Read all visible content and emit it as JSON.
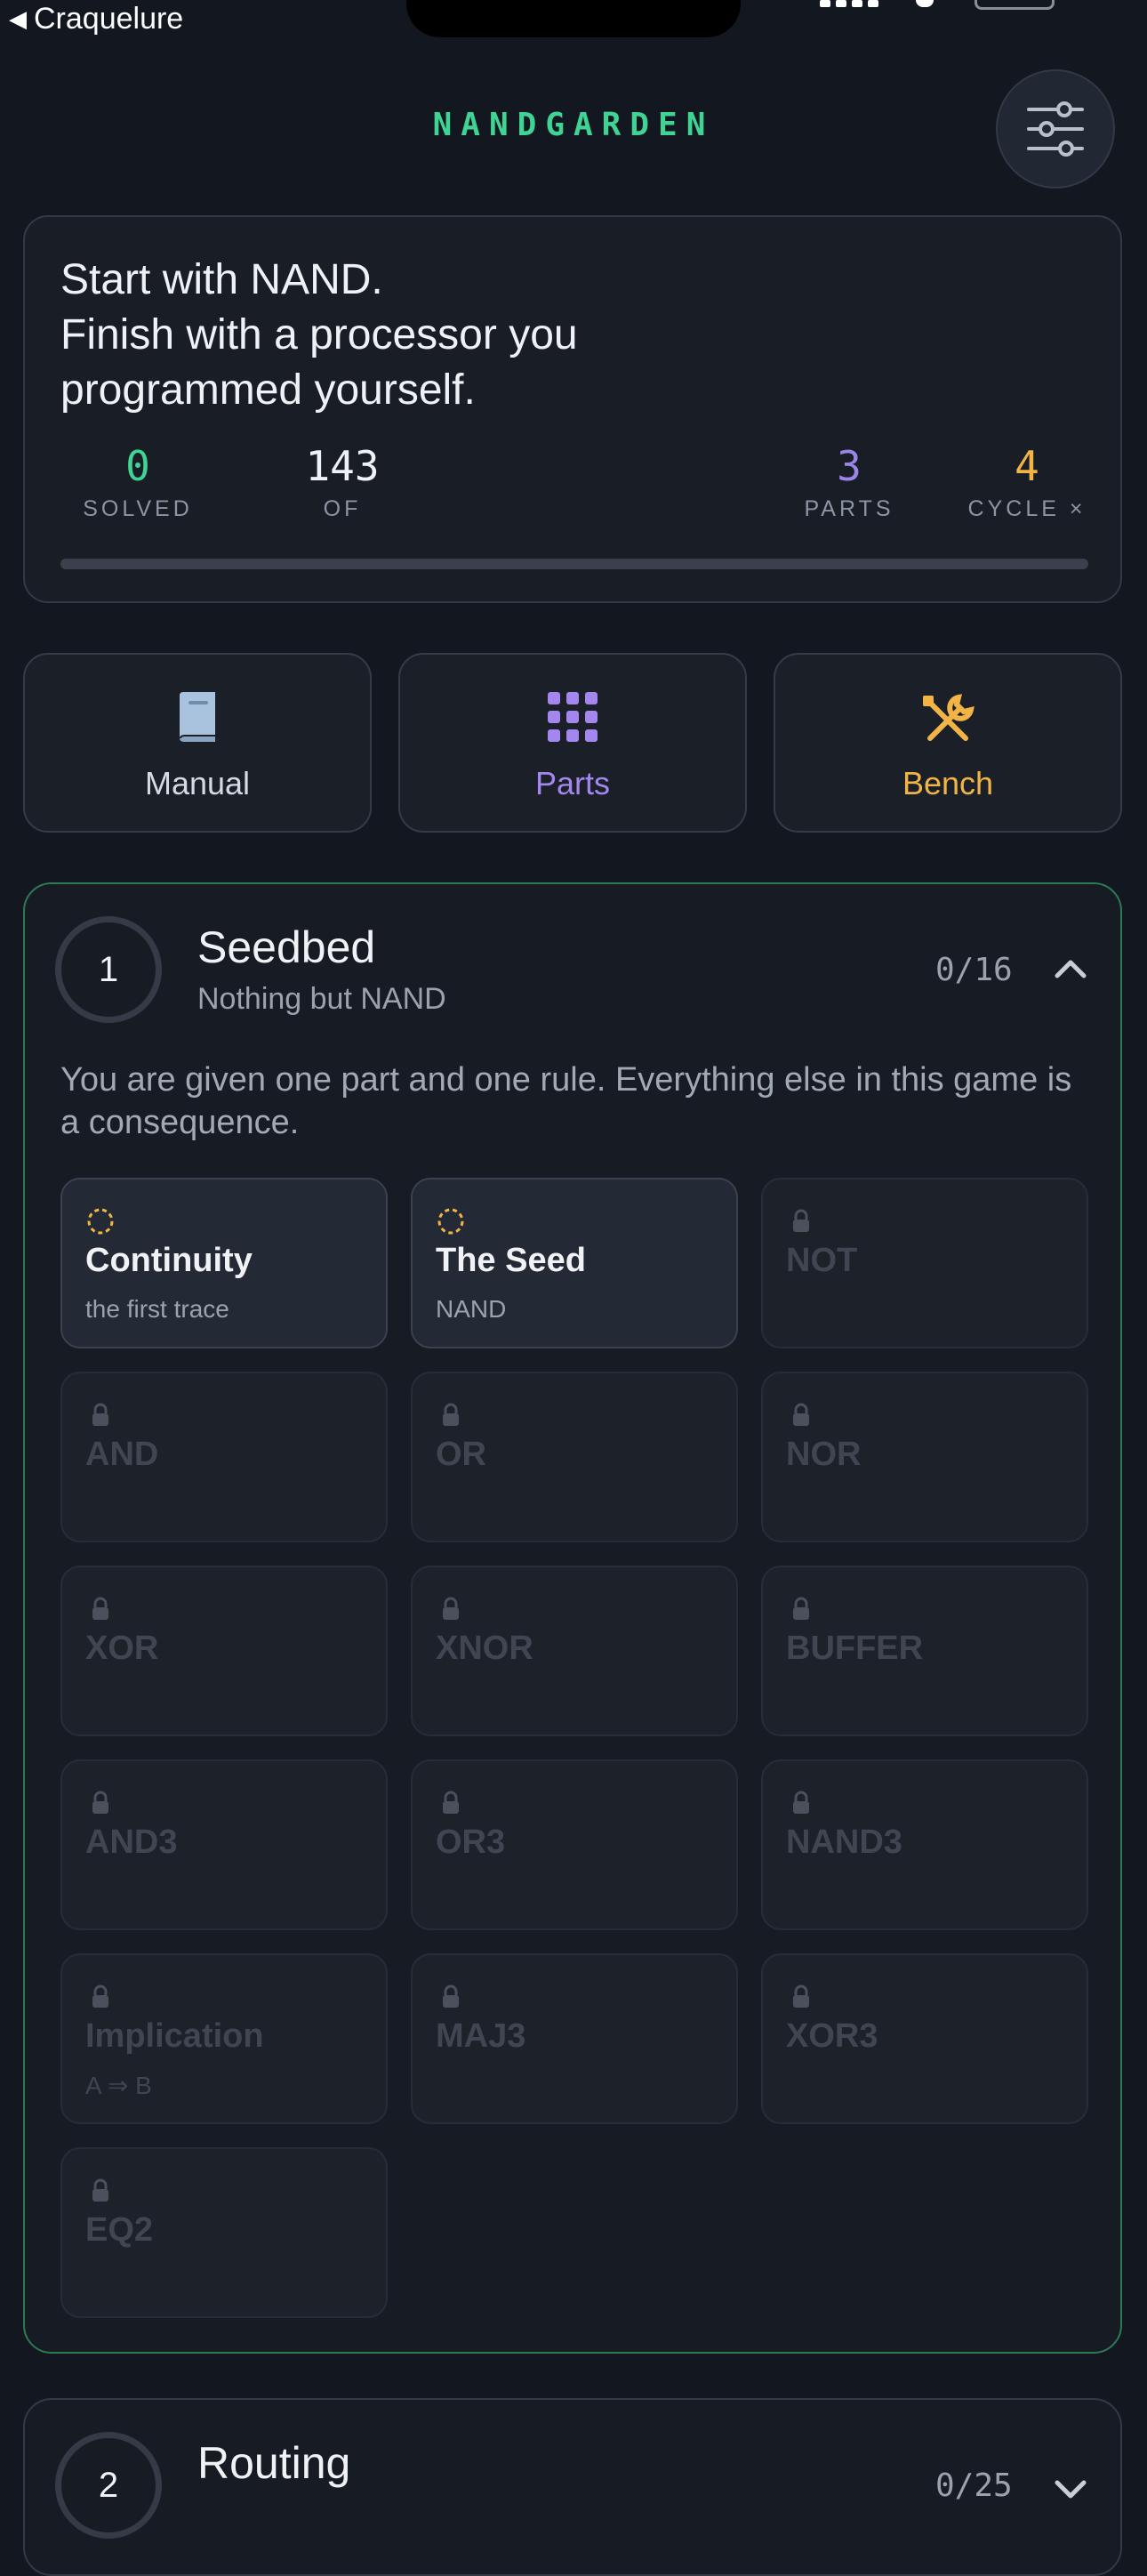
{
  "status_bar": {
    "back_label": "Craquelure"
  },
  "app": {
    "title": "NANDGARDEN"
  },
  "hero": {
    "lines": [
      "Start with NAND.",
      "Finish with a processor you",
      "programmed yourself."
    ],
    "stats": [
      {
        "value": "0",
        "label": "SOLVED",
        "color": "#3fd494"
      },
      {
        "value": "143",
        "label": "OF",
        "color": "#eef1f5"
      },
      {
        "value": "3",
        "label": "PARTS",
        "color": "#9b85e8"
      },
      {
        "value": "4",
        "label": "CYCLE ×",
        "color": "#f1b445"
      }
    ],
    "progress_fraction": 0
  },
  "nav": [
    {
      "label": "Manual",
      "icon": "book-icon",
      "color": "#d6dbe3"
    },
    {
      "label": "Parts",
      "icon": "grid-icon",
      "color": "#a487ee"
    },
    {
      "label": "Bench",
      "icon": "tools-icon",
      "color": "#f1b445"
    }
  ],
  "sections": [
    {
      "number": "1",
      "title": "Seedbed",
      "subtitle": "Nothing but NAND",
      "count": "0/16",
      "description": "You are given one part and one rule. Everything else in this game is a consequence.",
      "tiles": [
        {
          "name": "Continuity",
          "sub": "the first trace",
          "state": "open"
        },
        {
          "name": "The Seed",
          "sub": "NAND",
          "state": "open"
        },
        {
          "name": "NOT",
          "sub": "",
          "state": "locked"
        },
        {
          "name": "AND",
          "sub": "",
          "state": "locked"
        },
        {
          "name": "OR",
          "sub": "",
          "state": "locked"
        },
        {
          "name": "NOR",
          "sub": "",
          "state": "locked"
        },
        {
          "name": "XOR",
          "sub": "",
          "state": "locked"
        },
        {
          "name": "XNOR",
          "sub": "",
          "state": "locked"
        },
        {
          "name": "BUFFER",
          "sub": "",
          "state": "locked"
        },
        {
          "name": "AND3",
          "sub": "",
          "state": "locked"
        },
        {
          "name": "OR3",
          "sub": "",
          "state": "locked"
        },
        {
          "name": "NAND3",
          "sub": "",
          "state": "locked"
        },
        {
          "name": "Implication",
          "sub": "A ⇒ B",
          "state": "locked"
        },
        {
          "name": "MAJ3",
          "sub": "",
          "state": "locked"
        },
        {
          "name": "XOR3",
          "sub": "",
          "state": "locked"
        },
        {
          "name": "EQ2",
          "sub": "",
          "state": "locked"
        }
      ]
    },
    {
      "number": "2",
      "title": "Routing",
      "count": "0/25"
    }
  ]
}
